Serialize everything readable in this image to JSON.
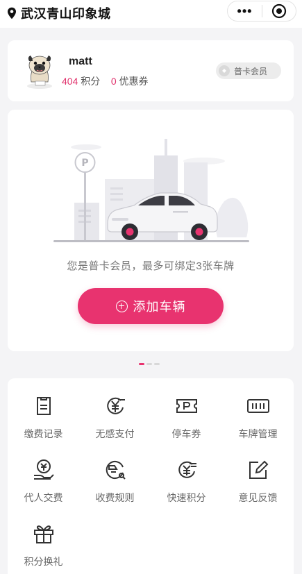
{
  "location": {
    "city": "武汉青山印象城"
  },
  "capsule": {
    "more": "•••"
  },
  "user": {
    "name": "matt",
    "points": "404",
    "points_label": "积分",
    "coupons": "0",
    "coupons_label": "优惠券",
    "badge": "普卡会员"
  },
  "binding": {
    "hint": "您是普卡会员，最多可绑定3张车牌",
    "add_button": "添加车辆"
  },
  "colors": {
    "accent": "#e8336f",
    "text": "#333333",
    "bg": "#f4f4f6"
  },
  "menu": [
    {
      "label": "缴费记录",
      "icon": "receipt-icon"
    },
    {
      "label": "无感支付",
      "icon": "yuan-pay-icon"
    },
    {
      "label": "停车券",
      "icon": "parking-ticket-icon"
    },
    {
      "label": "车牌管理",
      "icon": "license-plate-icon"
    },
    {
      "label": "代人交费",
      "icon": "pay-for-others-icon"
    },
    {
      "label": "收费规则",
      "icon": "fee-rules-icon"
    },
    {
      "label": "快速积分",
      "icon": "quick-points-icon"
    },
    {
      "label": "意见反馈",
      "icon": "feedback-icon"
    },
    {
      "label": "积分换礼",
      "icon": "gift-icon"
    }
  ]
}
